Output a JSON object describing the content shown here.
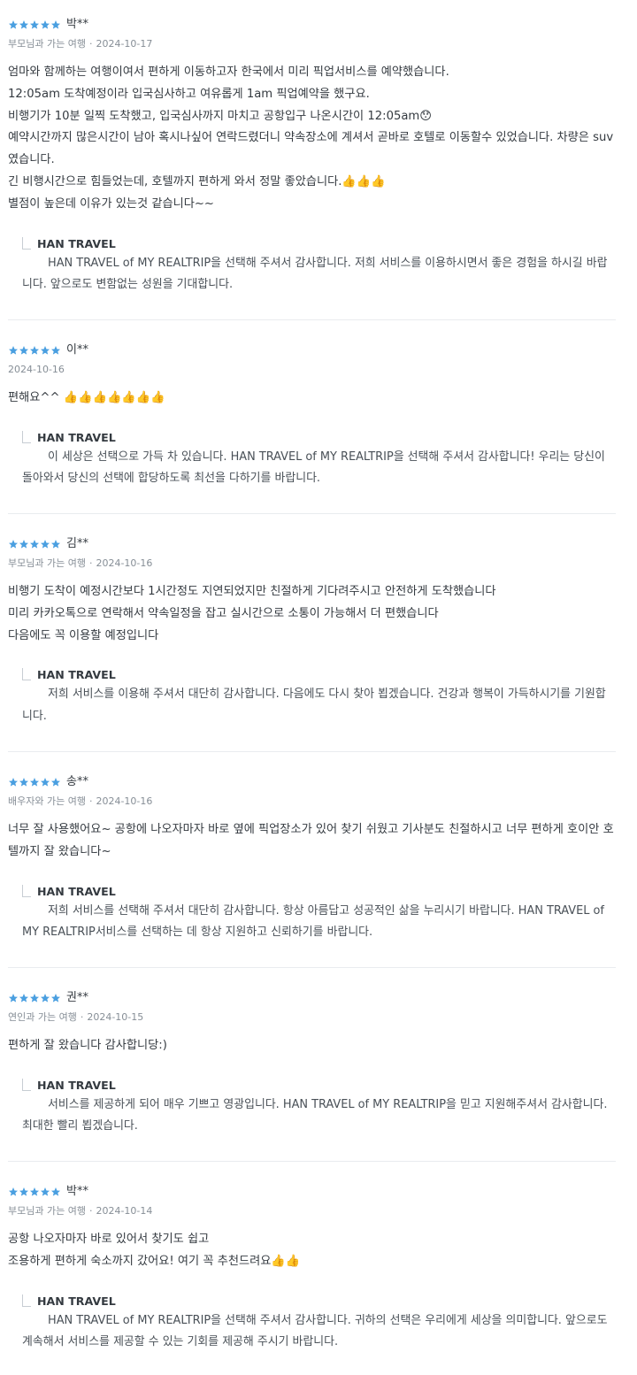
{
  "star_color": "#4a9fe0",
  "reviews": [
    {
      "reviewer": "박**",
      "trip_type": "부모님과 가는 여행",
      "date": "2024-10-17",
      "rating": 5,
      "body": "엄마와 함께하는 여행이여서 편하게 이동하고자 한국에서 미리 픽업서비스를 예약했습니다.\n12:05am 도착예정이라 입국심사하고 여유롭게 1am 픽업예약을 했구요.\n비행기가 10분 일찍 도착했고, 입국심사까지 마치고 공항입구 나온시간이 12:05am😯\n예약시간까지 많은시간이 남아 혹시나싶어 연락드렸더니 약속장소에 계셔서 곧바로 호텔로 이동할수 있었습니다. 차량은 suv 였습니다.\n긴 비행시간으로 힘들었는데, 호텔까지 편하게 와서 정말 좋았습니다.👍👍👍\n별점이 높은데 이유가 있는것 같습니다~~",
      "reply_name": "HAN TRAVEL",
      "reply_text": "HAN TRAVEL of MY REALTRIP을 선택해 주셔서 감사합니다. 저희 서비스를 이용하시면서 좋은 경험을 하시길 바랍니다. 앞으로도 변함없는 성원을 기대합니다."
    },
    {
      "reviewer": "이**",
      "trip_type": "",
      "date": "2024-10-16",
      "rating": 5,
      "body": "편해요^^ 👍👍👍👍👍👍👍",
      "reply_name": "HAN TRAVEL",
      "reply_text": "이 세상은 선택으로 가득 차 있습니다. HAN TRAVEL of MY REALTRIP을 선택해 주셔서 감사합니다! 우리는 당신이 돌아와서 당신의 선택에 합당하도록 최선을 다하기를 바랍니다."
    },
    {
      "reviewer": "김**",
      "trip_type": "부모님과 가는 여행",
      "date": "2024-10-16",
      "rating": 5,
      "body": "비행기 도착이 예정시간보다 1시간정도 지연되었지만 친절하게 기다려주시고 안전하게 도착했습니다\n미리 카카오톡으로 연락해서 약속일정을 잡고 실시간으로 소통이 가능해서 더 편했습니다\n다음에도 꼭 이용할 예정입니다",
      "reply_name": "HAN TRAVEL",
      "reply_text": "저희 서비스를 이용해 주셔서 대단히 감사합니다. 다음에도 다시 찾아 뵙겠습니다. 건강과 행복이 가득하시기를 기원합니다."
    },
    {
      "reviewer": "송**",
      "trip_type": "배우자와 가는 여행",
      "date": "2024-10-16",
      "rating": 5,
      "body": "너무 잘 사용했어요~ 공항에 나오자마자 바로 옆에 픽업장소가 있어 찾기 쉬웠고 기사분도 친절하시고 너무 편하게 호이안 호텔까지 잘 왔습니다~",
      "reply_name": "HAN TRAVEL",
      "reply_text": "저희 서비스를 선택해 주셔서 대단히 감사합니다. 항상 아름답고 성공적인 삶을 누리시기 바랍니다. HAN TRAVEL of MY REALTRIP서비스를 선택하는 데 항상 지원하고 신뢰하기를 바랍니다."
    },
    {
      "reviewer": "권**",
      "trip_type": "연인과 가는 여행",
      "date": "2024-10-15",
      "rating": 5,
      "body": "편하게 잘 왔습니다 감사합니당:)",
      "reply_name": "HAN TRAVEL",
      "reply_text": "서비스를 제공하게 되어 매우 기쁘고 영광입니다. HAN TRAVEL of MY REALTRIP을 믿고 지원해주셔서 감사합니다. 최대한 빨리 뵙겠습니다."
    },
    {
      "reviewer": "박**",
      "trip_type": "부모님과 가는 여행",
      "date": "2024-10-14",
      "rating": 5,
      "body": "공항 나오자마자 바로 있어서 찾기도 쉽고\n조용하게 편하게 숙소까지 갔어요! 여기 꼭 추천드려요👍👍",
      "reply_name": "HAN TRAVEL",
      "reply_text": "HAN TRAVEL of MY REALTRIP을 선택해 주셔서 감사합니다. 귀하의 선택은 우리에게 세상을 의미합니다. 앞으로도 계속해서 서비스를 제공할 수 있는 기회를 제공해 주시기 바랍니다."
    }
  ]
}
